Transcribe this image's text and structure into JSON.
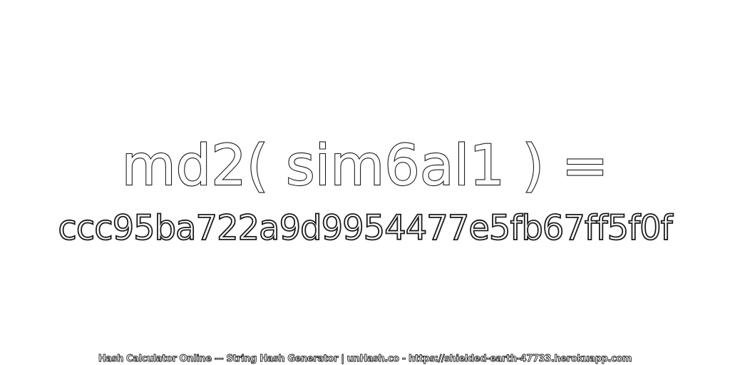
{
  "headline": "md2( sim6al1 ) =",
  "hash": "ccc95ba722a9d9954477e5fb67ff5f0f",
  "footer": "Hash Calculator Online — String Hash Generator | unHash.co - https://shielded-earth-47733.herokuapp.com"
}
